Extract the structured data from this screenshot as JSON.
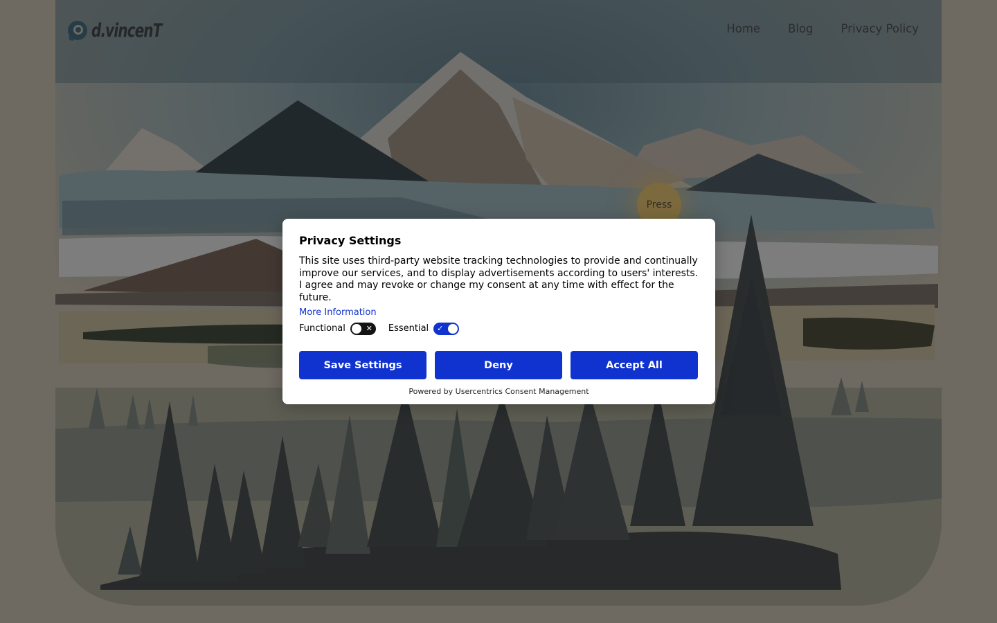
{
  "header": {
    "logo_text": "d.vincenT",
    "nav": [
      {
        "label": "Home"
      },
      {
        "label": "Blog"
      },
      {
        "label": "Privacy Policy"
      }
    ]
  },
  "hero": {
    "press_label": "Press"
  },
  "consent": {
    "title": "Privacy Settings",
    "body": "This site uses third-party website tracking technologies to provide and continually improve our services, and to display advertisements according to users' interests. I agree and may revoke or change my consent at any time with effect for the future.",
    "more_info_label": "More Information",
    "toggles": [
      {
        "label": "Functional",
        "checked": false
      },
      {
        "label": "Essential",
        "checked": true
      }
    ],
    "buttons": {
      "save": "Save Settings",
      "deny": "Deny",
      "accept": "Accept All"
    },
    "powered_by": "Powered by Usercentrics Consent Management",
    "accent_color": "#1032cf"
  }
}
